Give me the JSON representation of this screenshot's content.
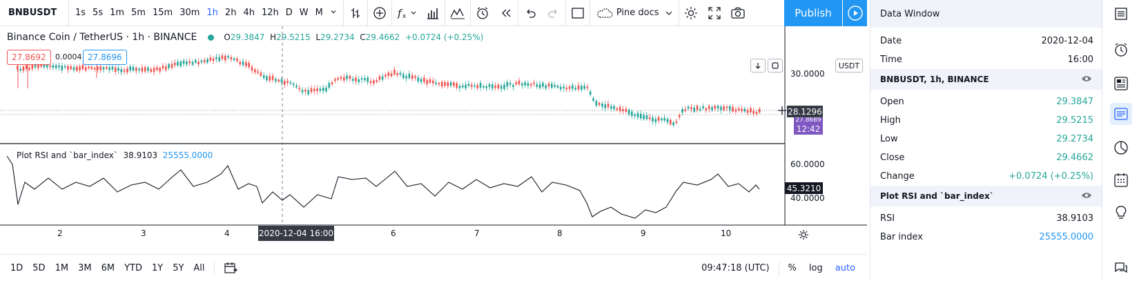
{
  "toolbar": {
    "symbol": "BNBUSDT",
    "intervals": [
      "1s",
      "5s",
      "1m",
      "5m",
      "15m",
      "30m",
      "1h",
      "2h",
      "4h",
      "12h",
      "D",
      "W",
      "M"
    ],
    "active_interval": "1h",
    "layout_name": "Pine docs",
    "publish_label": "Publish"
  },
  "chart": {
    "title": "Binance Coin / TetherUS · 1h · BINANCE",
    "ohlc": {
      "o_label": "O",
      "o": "29.3847",
      "h_label": "H",
      "h": "29.5215",
      "l_label": "L",
      "l": "29.2734",
      "c_label": "C",
      "c": "29.4662",
      "change": "+0.0724 (+0.25%)"
    },
    "sell_price": "27.8692",
    "spread": "0.0004",
    "buy_price": "27.8696",
    "currency": "USDT",
    "price_axis": [
      "30.0000",
      "28.1296",
      "27.8689",
      "12:42"
    ],
    "price_tag": "28.1296",
    "price_tag_hidden": "27.8689",
    "countdown": "12:42",
    "rsi_legend": {
      "name": "Plot RSI and `bar_index`",
      "value1": "38.9103",
      "value2": "25555.0000"
    },
    "rsi_axis": [
      "60.0000",
      "40.0000"
    ],
    "rsi_tag": "45.3210",
    "time_axis": [
      "2",
      "3",
      "4",
      "5",
      "6",
      "7",
      "8",
      "9",
      "10"
    ],
    "crosshair_time": "2020-12-04    16:00"
  },
  "bottombar": {
    "ranges": [
      "1D",
      "5D",
      "1M",
      "3M",
      "6M",
      "YTD",
      "1Y",
      "5Y",
      "All"
    ],
    "clock": "09:47:18 (UTC)",
    "percent": "%",
    "log": "log",
    "auto": "auto"
  },
  "data_window": {
    "title": "Data Window",
    "date_label": "Date",
    "date_value": "2020-12-04",
    "time_label": "Time",
    "time_value": "16:00",
    "section1": "BNBUSDT, 1h, BINANCE",
    "open_label": "Open",
    "open_value": "29.3847",
    "high_label": "High",
    "high_value": "29.5215",
    "low_label": "Low",
    "low_value": "29.2734",
    "close_label": "Close",
    "close_value": "29.4662",
    "change_label": "Change",
    "change_value": "+0.0724 (+0.25%)",
    "section2": "Plot RSI and `bar_index`",
    "rsi_label": "RSI",
    "rsi_value": "38.9103",
    "bar_label": "Bar index",
    "bar_value": "25555.0000"
  },
  "colors": {
    "up": "#26a69a",
    "down": "#ef5350",
    "accent": "#2196f3",
    "countdown": "#7e57c2",
    "tag_dark": "#363a45"
  },
  "sidebar_icons": [
    "watchlist-icon",
    "alert-clock-icon",
    "news-icon",
    "data-window-icon",
    "pie-chart-icon",
    "calendar-icon",
    "idea-bulb-icon",
    "chat-icon"
  ]
}
